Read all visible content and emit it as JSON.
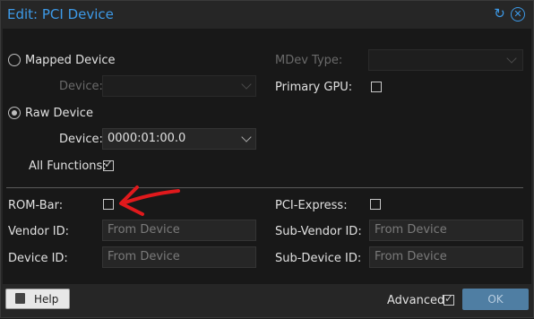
{
  "dialog": {
    "title": "Edit: PCI Device",
    "restore_icon": "restore-icon",
    "close_icon": "close-icon"
  },
  "left": {
    "mapped_device": {
      "label": "Mapped Device",
      "checked": false
    },
    "mapped_device_select": {
      "label": "Device:",
      "value": ""
    },
    "raw_device": {
      "label": "Raw Device",
      "checked": true
    },
    "raw_device_select": {
      "label": "Device:",
      "value": "0000:01:00.0"
    },
    "all_functions": {
      "label": "All Functions:",
      "checked": true
    },
    "rom_bar": {
      "label": "ROM-Bar:",
      "checked": false
    },
    "vendor_id": {
      "label": "Vendor ID:",
      "placeholder": "From Device"
    },
    "device_id": {
      "label": "Device ID:",
      "placeholder": "From Device"
    }
  },
  "right": {
    "mdev_type": {
      "label": "MDev Type:",
      "value": ""
    },
    "primary_gpu": {
      "label": "Primary GPU:",
      "checked": false
    },
    "pci_express": {
      "label": "PCI-Express:",
      "checked": false
    },
    "sub_vendor_id": {
      "label": "Sub-Vendor ID:",
      "placeholder": "From Device"
    },
    "sub_device_id": {
      "label": "Sub-Device ID:",
      "placeholder": "From Device"
    }
  },
  "footer": {
    "help_label": "Help",
    "advanced_label": "Advanced",
    "advanced_checked": true,
    "ok_label": "OK"
  },
  "colors": {
    "accent": "#3d9ae8",
    "annotation_arrow": "#e0191c",
    "ok_button": "#4f7ea3"
  }
}
